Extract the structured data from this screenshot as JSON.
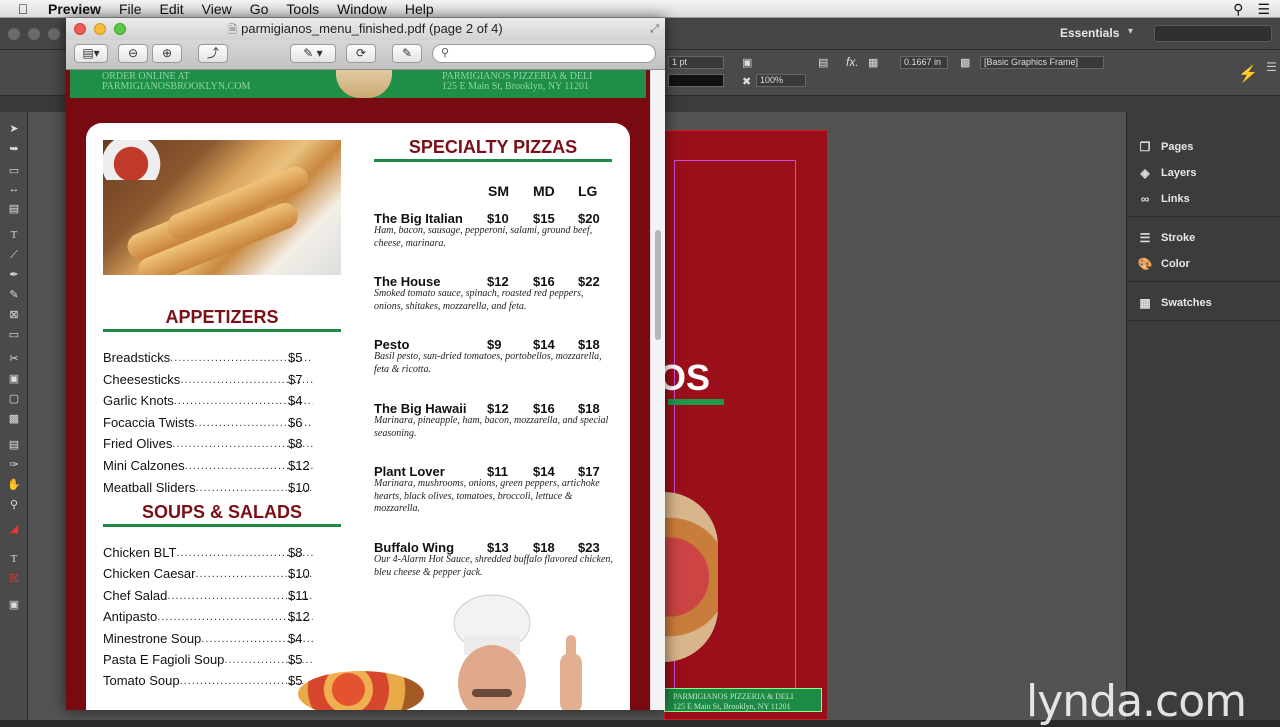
{
  "menubar": {
    "app": "Preview",
    "items": [
      "File",
      "Edit",
      "View",
      "Go",
      "Tools",
      "Window",
      "Help"
    ]
  },
  "indesign": {
    "workspace": "Essentials",
    "control": {
      "stroke_weight": "1 pt",
      "zoom": "100%",
      "offset": "0.1667 in",
      "style": "[Basic Graphics Frame]"
    },
    "panels": [
      "Pages",
      "Layers",
      "Links",
      "Stroke",
      "Color",
      "Swatches"
    ],
    "page_big_text": "OS",
    "page_footer": "PARMIGIANOS PIZZERIA & DELI\n125 E Main St, Brooklyn, NY 11201"
  },
  "preview": {
    "title": "parmigianos_menu_finished.pdf (page 2 of 4)",
    "search_placeholder": ""
  },
  "menu": {
    "top_left": "ORDER ONLINE AT\nPARMIGIANOSBROOKLYN.COM",
    "top_right": "PARMIGIANOS PIZZERIA & DELI\n125 E Main St, Brooklyn, NY 11201",
    "appetizers_title": "APPETIZERS",
    "appetizers": [
      {
        "name": "Breadsticks",
        "price": "$5"
      },
      {
        "name": "Cheesesticks",
        "price": "$7"
      },
      {
        "name": "Garlic Knots",
        "price": "$4"
      },
      {
        "name": "Focaccia Twists",
        "price": "$6"
      },
      {
        "name": "Fried Olives",
        "price": "$8"
      },
      {
        "name": "Mini Calzones",
        "price": "$12"
      },
      {
        "name": "Meatball Sliders",
        "price": "$10"
      }
    ],
    "soups_title": "SOUPS & SALADS",
    "soups": [
      {
        "name": "Chicken BLT",
        "price": "$8"
      },
      {
        "name": "Chicken Caesar",
        "price": "$10"
      },
      {
        "name": "Chef Salad",
        "price": "$11"
      },
      {
        "name": "Antipasto",
        "price": "$12"
      },
      {
        "name": "Minestrone Soup",
        "price": "$4"
      },
      {
        "name": "Pasta E Fagioli Soup",
        "price": "$5"
      },
      {
        "name": "Tomato Soup",
        "price": "$5"
      }
    ],
    "pizzas_title": "SPECIALTY PIZZAS",
    "sizes": [
      "SM",
      "MD",
      "LG"
    ],
    "pizzas": [
      {
        "name": "The Big Italian",
        "sm": "$10",
        "md": "$15",
        "lg": "$20",
        "desc": "Ham, bacon, sausage, pepperoni, salami, ground beef, cheese, marinara."
      },
      {
        "name": "The House",
        "sm": "$12",
        "md": "$16",
        "lg": "$22",
        "desc": "Smoked tomato sauce, spinach, roasted red peppers, onions, shitakes, mozzarella, and feta."
      },
      {
        "name": "Pesto",
        "sm": "$9",
        "md": "$14",
        "lg": "$18",
        "desc": "Basil pesto, sun-dried tomatoes, portobellos, mozzarella, feta & ricotta."
      },
      {
        "name": "The Big Hawaii",
        "sm": "$12",
        "md": "$16",
        "lg": "$18",
        "desc": "Marinara, pineapple, ham, bacon, mozzarella, and special seasoning."
      },
      {
        "name": "Plant Lover",
        "sm": "$11",
        "md": "$14",
        "lg": "$17",
        "desc": "Marinara, mushrooms, onions, green peppers, artichoke hearts, black olives, tomatoes, broccoli, lettuce & mozzarella."
      },
      {
        "name": "Buffalo Wing",
        "sm": "$13",
        "md": "$18",
        "lg": "$23",
        "desc": "Our 4-Alarm Hot Sauce, shredded buffalo flavored chicken, bleu cheese & pepper jack."
      }
    ]
  },
  "watermark": "lynda.com"
}
